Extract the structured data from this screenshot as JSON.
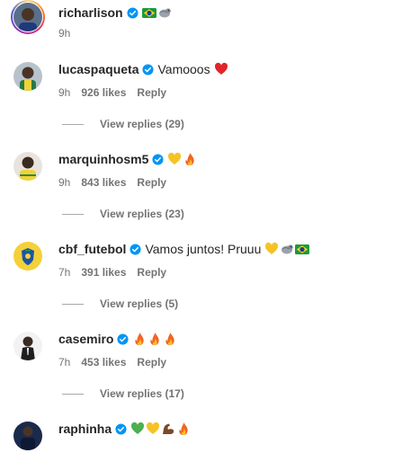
{
  "post": {
    "username": "richarlison",
    "time": "9h",
    "emojis": [
      "brazil-flag",
      "pigeon"
    ]
  },
  "comments": [
    {
      "username": "lucaspaqueta",
      "text": "Vamooos",
      "emojis": [
        "red-heart"
      ],
      "time": "9h",
      "likes": "926 likes",
      "reply_label": "Reply",
      "view_replies": "View replies (29)"
    },
    {
      "username": "marquinhosm5",
      "text": "",
      "emojis": [
        "yellow-heart",
        "fire"
      ],
      "time": "9h",
      "likes": "843 likes",
      "reply_label": "Reply",
      "view_replies": "View replies (23)"
    },
    {
      "username": "cbf_futebol",
      "text": "Vamos juntos! Pruuu",
      "emojis": [
        "yellow-heart",
        "pigeon",
        "brazil-flag"
      ],
      "time": "7h",
      "likes": "391 likes",
      "reply_label": "Reply",
      "view_replies": "View replies (5)"
    },
    {
      "username": "casemiro",
      "text": "",
      "emojis": [
        "fire",
        "fire",
        "fire"
      ],
      "time": "7h",
      "likes": "453 likes",
      "reply_label": "Reply",
      "view_replies": "View replies (17)"
    },
    {
      "username": "raphinha",
      "text": "",
      "emojis": [
        "green-heart",
        "yellow-heart",
        "flexed-biceps",
        "fire"
      ],
      "time": "",
      "likes": "",
      "reply_label": "",
      "view_replies": ""
    }
  ],
  "colors": {
    "verified_blue": "#0095f6",
    "secondary_text": "#737373",
    "primary_text": "#262626"
  }
}
